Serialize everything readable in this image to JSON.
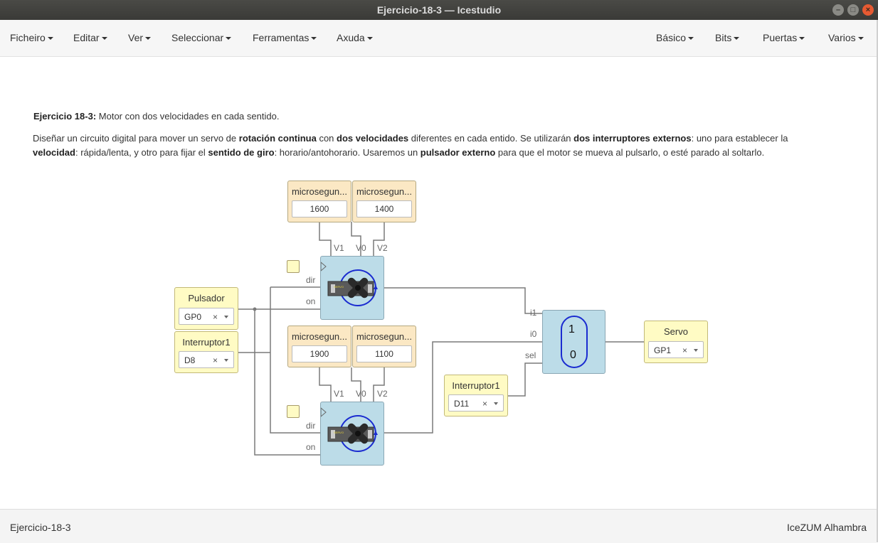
{
  "window": {
    "title": "Ejercicio-18-3 — Icestudio"
  },
  "menus_left": [
    "Ficheiro",
    "Editar",
    "Ver",
    "Seleccionar",
    "Ferramentas",
    "Axuda"
  ],
  "menus_right": [
    "Básico",
    "Bits",
    "Puertas",
    "Varios"
  ],
  "description": {
    "heading_bold": "Ejercicio 18-3:",
    "heading_rest": " Motor con dos velocidades en cada sentido.",
    "line1_parts": [
      "Diseñar un circuito digital para mover un servo de ",
      "rotación continua",
      " con ",
      "dos velocidades",
      " diferentes en cada entido. Se utilizarán ",
      "dos interruptores externos",
      ": uno para establecer la"
    ],
    "line2_parts": [
      "velocidad",
      ": rápida/lenta, y otro para fijar el ",
      "sentido de giro",
      ": horario/antohorario. Usaremos un ",
      "pulsador externo",
      " para que el motor se mueva al pulsarlo, o esté parado al soltarlo."
    ]
  },
  "constants": [
    {
      "label": "microsegun...",
      "value": "1600"
    },
    {
      "label": "microsegun...",
      "value": "1400"
    },
    {
      "label": "microsegun...",
      "value": "1900"
    },
    {
      "label": "microsegun...",
      "value": "1100"
    }
  ],
  "inputs": [
    {
      "label": "Pulsador",
      "pin": "GP0"
    },
    {
      "label": "Interruptor1",
      "pin": "D8"
    },
    {
      "label": "Interruptor1",
      "pin": "D11"
    }
  ],
  "output": {
    "label": "Servo",
    "pin": "GP1"
  },
  "servo_ports": {
    "v1": "V1",
    "v0": "V0",
    "v2": "V2",
    "dir": "dir",
    "on": "on"
  },
  "mux": {
    "i1": "i1",
    "i0": "i0",
    "sel": "sel",
    "top": "1",
    "bottom": "0"
  },
  "clear_symbol": "×",
  "status": {
    "left": "Ejercicio-18-3",
    "right": "IceZUM Alhambra"
  }
}
